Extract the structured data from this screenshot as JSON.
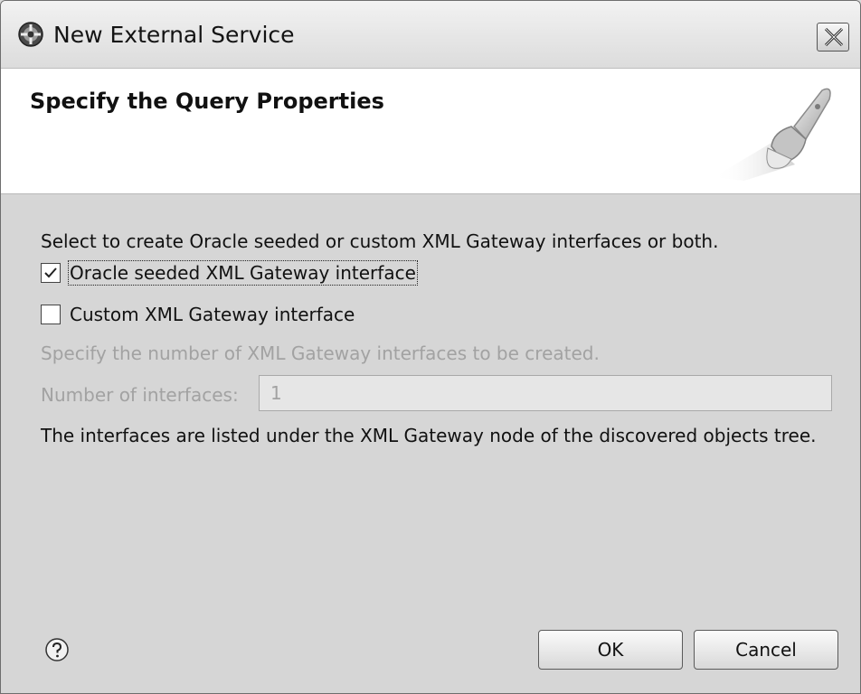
{
  "window": {
    "title": "New External Service"
  },
  "banner": {
    "title": "Specify the Query Properties"
  },
  "content": {
    "description": "Select to create Oracle seeded or custom XML Gateway interfaces or both.",
    "options": [
      {
        "label": "Oracle seeded XML Gateway interface",
        "checked": true
      },
      {
        "label": "Custom XML Gateway interface",
        "checked": false
      }
    ],
    "specify_text": "Specify the number of XML Gateway interfaces to be created.",
    "number_label": "Number of interfaces:",
    "number_value": "1",
    "info_text": "The interfaces are listed under the XML Gateway node of the discovered objects tree."
  },
  "footer": {
    "ok_label": "OK",
    "cancel_label": "Cancel"
  },
  "icons": {
    "app": "service-icon",
    "close": "close-icon",
    "wizard": "wizard-brush-icon",
    "help": "help-icon"
  }
}
